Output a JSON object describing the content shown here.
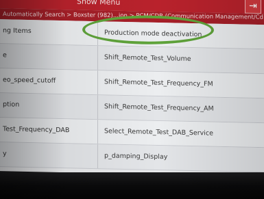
{
  "header": {
    "title": "Show Menu",
    "exit_icon": "exit-icon"
  },
  "breadcrumb": "Automatically Search > Boxster (982)...ion > PCM/CDR (Communication Management/Cd Radio)",
  "rows": [
    {
      "left": "ng Items",
      "right": "Production mode deactivation"
    },
    {
      "left": "e",
      "right": "Shift_Remote_Test_Volume"
    },
    {
      "left": "eo_speed_cutoff",
      "right": "Shift_Remote_Test_Frequency_FM"
    },
    {
      "left": "ption",
      "right": "Shift_Remote_Test_Frequency_AM"
    },
    {
      "left": "Test_Frequency_DAB",
      "right": "Select_Remote_Test_DAB_Service"
    },
    {
      "left": "y",
      "right": "p_damping_Display"
    }
  ],
  "colors": {
    "header_red": "#b9222c",
    "highlight_green": "#5fa33a"
  }
}
